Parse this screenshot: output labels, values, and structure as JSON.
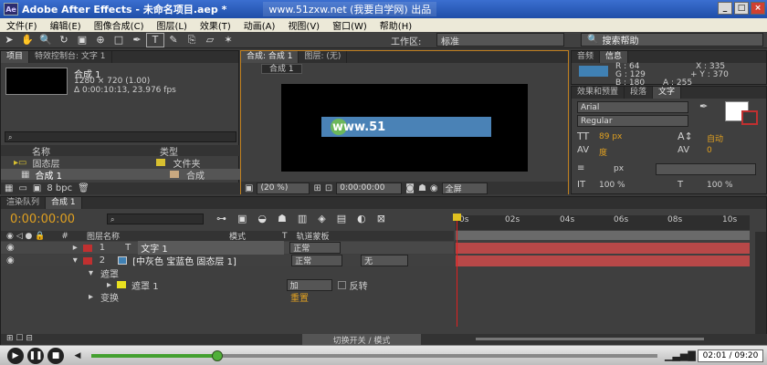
{
  "window": {
    "title": "Adobe After Effects - 未命名项目.aep *",
    "watermark": "www.51zxw.net (我要自学网) 出品",
    "minimize": "_",
    "maximize": "□",
    "close": "×"
  },
  "menu": [
    "文件(F)",
    "编辑(E)",
    "图像合成(C)",
    "图层(L)",
    "效果(T)",
    "动画(A)",
    "视图(V)",
    "窗口(W)",
    "帮助(H)"
  ],
  "toolbar": {
    "workspace_label": "工作区:",
    "workspace_value": "标准",
    "search_help": "搜索帮助"
  },
  "project": {
    "tabs": [
      "项目",
      "特效控制台: 文字 1"
    ],
    "comp_name": "合成 1",
    "comp_size": "1280 × 720 (1.00)",
    "comp_duration": "Δ 0:00:10:13, 23.976 fps",
    "col_name": "名称",
    "col_type": "类型",
    "items": [
      {
        "name": "固态层",
        "type": "文件夹",
        "color": "#d8c030"
      },
      {
        "name": "合成 1",
        "type": "合成",
        "color": "#c8a880"
      }
    ],
    "bpc": "8 bpc"
  },
  "composition": {
    "tabs": [
      "合成: 合成 1",
      "图层: (无)"
    ],
    "breadcrumb": "合成 1",
    "text_content": "www.51",
    "zoom": "(20 %)",
    "timecode": "0:00:00:00",
    "resolution": "全屏"
  },
  "info": {
    "tabs": [
      "音频",
      "信息"
    ],
    "r": "R : 64",
    "g": "G : 129",
    "b": "B : 180",
    "a": "A : 255",
    "x": "X : 335",
    "y": "+ Y : 370",
    "swatch": "#4081b4"
  },
  "character": {
    "tabs": [
      "效果和预置",
      "段落",
      "文字"
    ],
    "font": "Arial",
    "style": "Regular",
    "size": "89 px",
    "leading": "自动",
    "kerning": "度",
    "tracking": "0",
    "unit": "px",
    "vscale": "100 %",
    "hscale": "100 %"
  },
  "timeline": {
    "tabs": [
      "渲染队列",
      "合成 1"
    ],
    "timecode": "0:00:00:00",
    "col_layer_name": "图层名称",
    "col_mode": "模式",
    "col_t": "T",
    "col_trkmat": "轨道蒙板",
    "ticks": [
      "0s",
      "02s",
      "04s",
      "06s",
      "08s",
      "10s"
    ],
    "layers": [
      {
        "num": "1",
        "icon": "T",
        "name": "文字 1",
        "mode": "正常",
        "trkmat": "",
        "color": "#c03030"
      },
      {
        "num": "2",
        "icon": "",
        "name": "[中灰色 宝蓝色 固态层 1]",
        "mode": "正常",
        "trkmat": "无",
        "color": "#c03030"
      }
    ],
    "mask_group": "遮罩",
    "mask_item": "遮罩 1",
    "mask_mode": "加",
    "mask_invert": "反转",
    "transform": "变换",
    "transform_reset": "重置",
    "switch_mode": "切换开关 / 模式"
  },
  "player": {
    "time": "02:01 / 09:20"
  }
}
